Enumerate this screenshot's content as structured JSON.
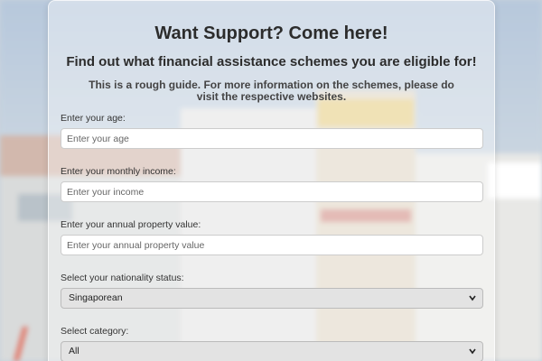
{
  "header": {
    "title": "Want Support? Come here!",
    "subtitle": "Find out what financial assistance schemes you are eligible for!",
    "guide": "This is a rough guide. For more information on the schemes, please do visit the respective websites."
  },
  "form": {
    "age": {
      "label": "Enter your age:",
      "placeholder": "Enter your age",
      "value": ""
    },
    "income": {
      "label": "Enter your monthly income:",
      "placeholder": "Enter your income",
      "value": ""
    },
    "property": {
      "label": "Enter your annual property value:",
      "placeholder": "Enter your annual property value",
      "value": ""
    },
    "nationality": {
      "label": "Select your nationality status:",
      "selected": "Singaporean",
      "icon": "chevron-down-icon"
    },
    "category": {
      "label": "Select category:",
      "selected": "All",
      "icon": "chevron-down-icon"
    }
  }
}
